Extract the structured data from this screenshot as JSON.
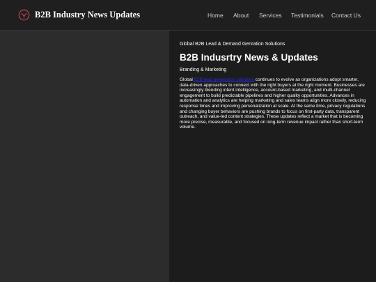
{
  "header": {
    "site_title": "B2B Industry News Updates",
    "logo_icon": "circle-logo-icon",
    "logo_color": "#c0465a"
  },
  "nav": {
    "items": [
      {
        "label": "Home"
      },
      {
        "label": "About"
      },
      {
        "label": "Services"
      },
      {
        "label": "Testimonials"
      },
      {
        "label": "Contact Us"
      }
    ]
  },
  "article": {
    "kicker": "Global B2B Lead & Demand Genration Solutions",
    "title": "B2B Indusrtry News & Updates",
    "category": "Branding & Marketing",
    "body_prefix": "Global ",
    "link_text": "B2B lead generation solutions",
    "body_rest": " continues to evolve as organizations adopt smarter, data-driven approaches to connect with the right buyers at the right moment. Businesses are increasingly blending intent intelligence, account-based marketing, and multi-channel engagement to build predictable pipelines and higher quality opportunities. Advances in automation and analytics are helping marketing and sales teams align more closely, reducing response times and improving personalization at scale. At the same time, privacy regulations and changing buyer behaviors are pushing brands to focus on first-party data, transparent outreach, and value-led content strategies. These updates reflect a market that is becoming more precise, measurable, and focused on long-term revenue impact rather than short-term volume.",
    "link_color": "#2a2ad8"
  }
}
